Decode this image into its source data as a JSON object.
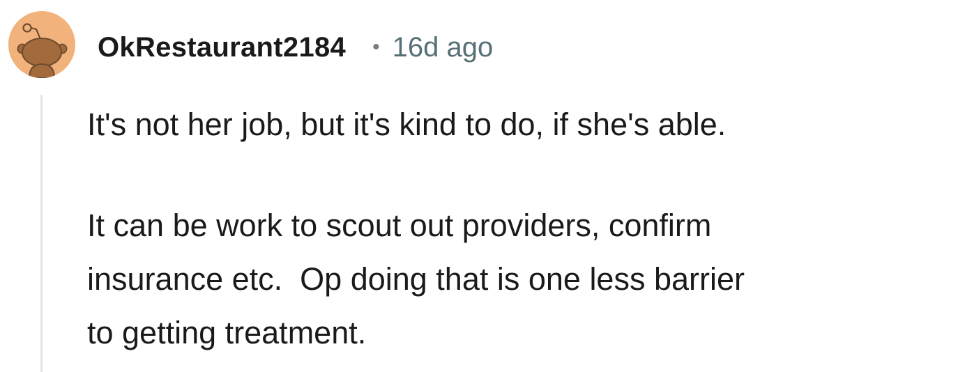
{
  "comment": {
    "author": {
      "username": "OkRestaurant2184",
      "avatar_icon": "snoo-avatar-icon",
      "avatar_bg": "#f2b27c"
    },
    "separator": "•",
    "timestamp": "16d ago",
    "paragraphs": [
      "It's not her job, but it's kind to do, if she's able.",
      "It can be work to scout out providers, confirm\ninsurance etc.  Op doing that is one less barrier\nto getting treatment."
    ]
  }
}
